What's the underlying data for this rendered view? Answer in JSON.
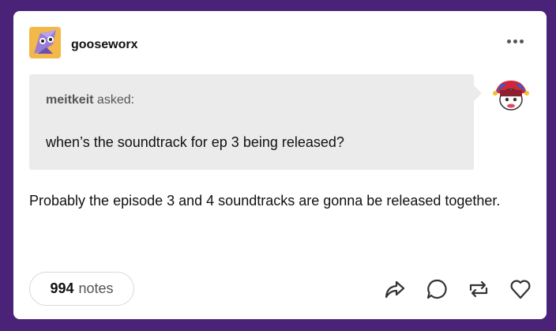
{
  "post": {
    "username": "gooseworx",
    "asker": {
      "name": "meitkeit",
      "suffix": "asked:"
    },
    "question": "when’s the soundtrack for ep 3 being released?",
    "answer": "Probably the episode 3 and 4 soundtracks are gonna be released together.",
    "notes": {
      "count": "994",
      "label": "notes"
    }
  },
  "icons": {
    "more": "more-dots-icon",
    "share": "share-icon",
    "reply": "reply-icon",
    "reblog": "reblog-icon",
    "like": "heart-icon"
  },
  "colors": {
    "background": "#4a2378",
    "card": "#ffffff",
    "ask_box": "#ebebeb"
  }
}
